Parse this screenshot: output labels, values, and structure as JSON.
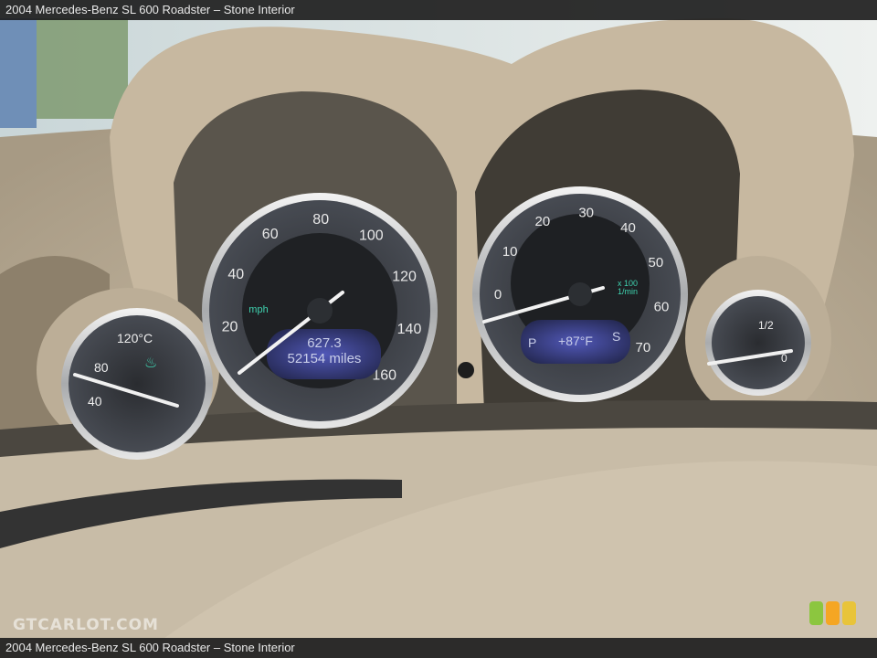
{
  "caption_top": "2004 Mercedes-Benz SL 600 Roadster – Stone Interior",
  "caption_bottom": "2004 Mercedes-Benz SL 600 Roadster – Stone Interior",
  "watermark": "GTCARLOT.COM",
  "speedometer": {
    "ticks": [
      "20",
      "40",
      "60",
      "80",
      "100",
      "120",
      "140",
      "160"
    ],
    "unit": "mph",
    "trip": "627.3",
    "odometer": "52154 miles",
    "reading_mph": 0
  },
  "tachometer": {
    "ticks": [
      "0",
      "10",
      "20",
      "30",
      "40",
      "50",
      "60",
      "70"
    ],
    "unit_line1": "x 100",
    "unit_line2": "1/min",
    "gear": "P",
    "temperature": "+87°F",
    "mode": "S",
    "reading": 0
  },
  "coolant_gauge": {
    "ticks": [
      "40",
      "80",
      "120°C"
    ]
  },
  "fuel_gauge": {
    "ticks": [
      "1/2",
      "0"
    ]
  },
  "badge_colors": [
    "#8cc63f",
    "#f5a623",
    "#e8c43a"
  ]
}
